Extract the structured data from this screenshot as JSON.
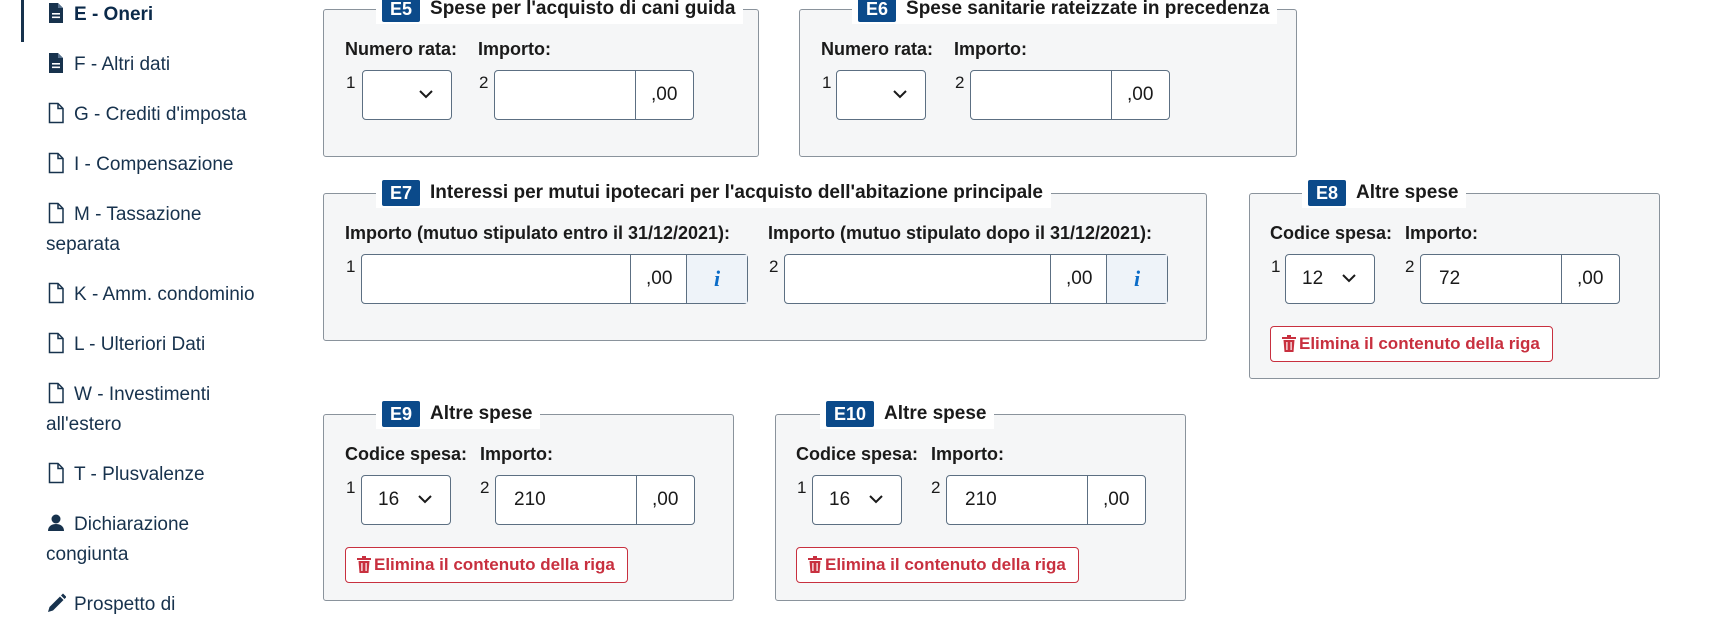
{
  "sidebar": {
    "items": [
      {
        "label": "E - Oneri",
        "icon": "document-filled-icon"
      },
      {
        "label": "F - Altri dati",
        "icon": "document-filled-icon"
      },
      {
        "label": "G - Crediti d'imposta",
        "icon": "document-outline-icon"
      },
      {
        "label": "I - Compensazione",
        "icon": "document-outline-icon"
      },
      {
        "label": "M - Tassazione",
        "label2": "separata",
        "icon": "document-outline-icon"
      },
      {
        "label": "K - Amm. condominio",
        "icon": "document-outline-icon"
      },
      {
        "label": "L - Ulteriori Dati",
        "icon": "document-outline-icon"
      },
      {
        "label": "W - Investimenti",
        "label2": "all'estero",
        "icon": "document-outline-icon"
      },
      {
        "label": "T - Plusvalenze",
        "icon": "document-outline-icon"
      },
      {
        "label": "Dichiarazione",
        "label2": "congiunta",
        "icon": "person-icon"
      },
      {
        "label": "Prospetto di",
        "icon": "pencil-icon"
      }
    ]
  },
  "e5": {
    "code": "E5",
    "title": "Spese per l'acquisto di cani guida",
    "label1": "Numero rata:",
    "label2": "Importo:",
    "n1": "1",
    "n2": "2",
    "select": "",
    "amount": "",
    "dec": ",00"
  },
  "e6": {
    "code": "E6",
    "title": "Spese sanitarie rateizzate in precedenza",
    "label1": "Numero rata:",
    "label2": "Importo:",
    "n1": "1",
    "n2": "2",
    "select": "",
    "amount": "",
    "dec": ",00"
  },
  "e7": {
    "code": "E7",
    "title": "Interessi per mutui ipotecari per l'acquisto dell'abitazione principale",
    "label1": "Importo (mutuo stipulato entro il 31/12/2021):",
    "label2": "Importo (mutuo stipulato dopo il 31/12/2021):",
    "n1": "1",
    "n2": "2",
    "amount1": "",
    "amount2": "",
    "dec": ",00",
    "info": "i"
  },
  "e8": {
    "code": "E8",
    "title": "Altre spese",
    "label1": "Codice spesa:",
    "label2": "Importo:",
    "n1": "1",
    "n2": "2",
    "select": "12",
    "amount": "72",
    "dec": ",00",
    "delete": "Elimina il contenuto della riga"
  },
  "e9": {
    "code": "E9",
    "title": "Altre spese",
    "label1": "Codice spesa:",
    "label2": "Importo:",
    "n1": "1",
    "n2": "2",
    "select": "16",
    "amount": "210",
    "dec": ",00",
    "delete": "Elimina il contenuto della riga"
  },
  "e10": {
    "code": "E10",
    "title": "Altre spese",
    "label1": "Codice spesa:",
    "label2": "Importo:",
    "n1": "1",
    "n2": "2",
    "select": "16",
    "amount": "210",
    "dec": ",00",
    "delete": "Elimina il contenuto della riga"
  },
  "colors": {
    "primary": "#0b4a8a",
    "danger": "#c8303f",
    "nav": "#17324d"
  }
}
